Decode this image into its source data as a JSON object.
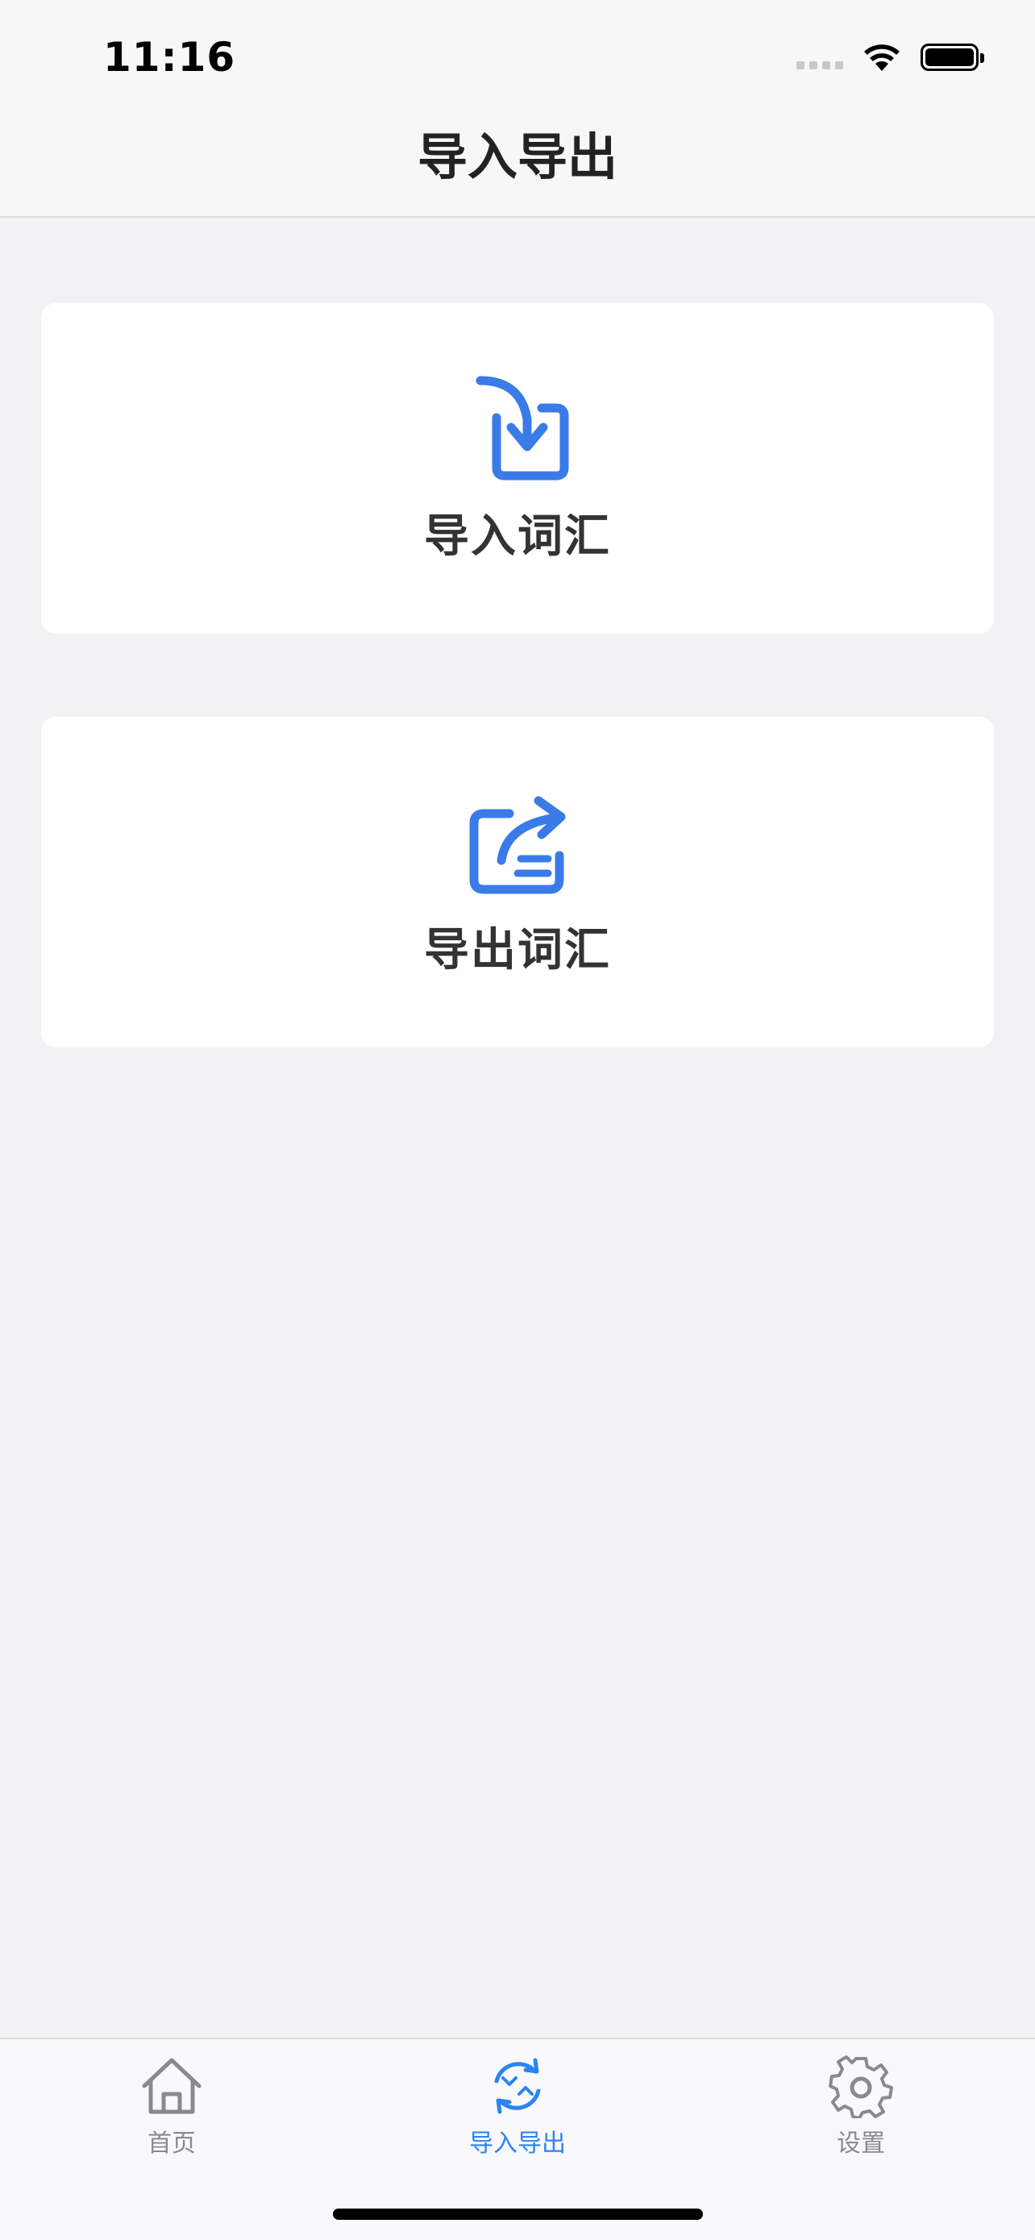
{
  "status_bar": {
    "time": "11:16"
  },
  "nav": {
    "title": "导入导出"
  },
  "cards": {
    "import_label": "导入词汇",
    "export_label": "导出词汇"
  },
  "tabs": [
    {
      "label": "首页",
      "icon": "home-icon",
      "active": false
    },
    {
      "label": "导入导出",
      "icon": "sync-icon",
      "active": true
    },
    {
      "label": "设置",
      "icon": "gear-icon",
      "active": false
    }
  ],
  "colors": {
    "accent": "#2a84f2",
    "icon_blue": "#3a7be8",
    "inactive": "#8a8a8e",
    "background": "#f2f1f3"
  }
}
